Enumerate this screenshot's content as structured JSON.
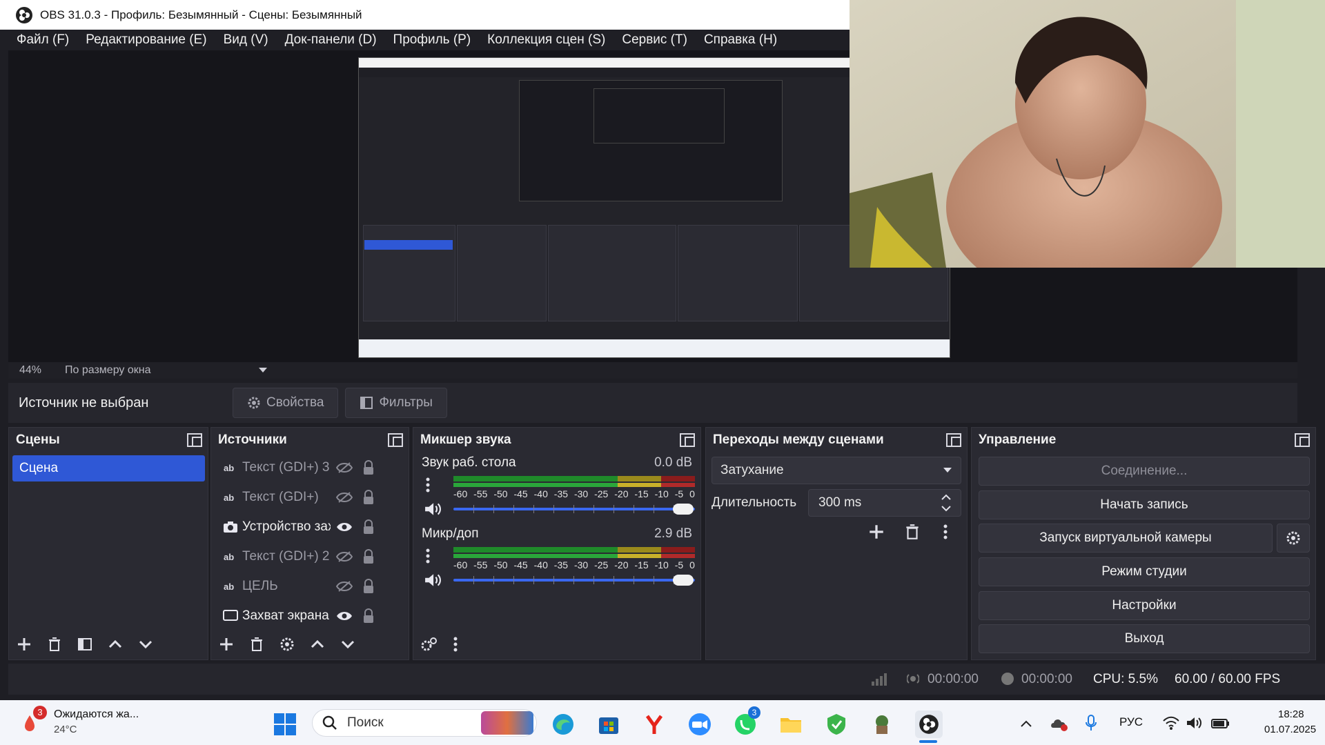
{
  "window": {
    "title": "OBS 31.0.3 - Профиль: Безымянный - Сцены: Безымянный"
  },
  "menu": [
    "Файл (F)",
    "Редактирование (E)",
    "Вид (V)",
    "Док-панели (D)",
    "Профиль (P)",
    "Коллекция сцен (S)",
    "Сервис (T)",
    "Справка (H)"
  ],
  "zoom": {
    "percent": "44%",
    "mode": "По размеру окна"
  },
  "source_toolbar": {
    "no_source": "Источник не выбран",
    "properties": "Свойства",
    "filters": "Фильтры"
  },
  "scenes": {
    "title": "Сцены",
    "items": [
      "Сцена"
    ]
  },
  "sources": {
    "title": "Источники",
    "items": [
      {
        "type": "text",
        "name": "Текст (GDI+) 3",
        "visible": false
      },
      {
        "type": "text",
        "name": "Текст (GDI+)",
        "visible": false
      },
      {
        "type": "camera",
        "name": "Устройство захвата видео",
        "visible": true
      },
      {
        "type": "text",
        "name": "Текст (GDI+) 2",
        "visible": false
      },
      {
        "type": "text",
        "name": "ЦЕЛЬ",
        "visible": false
      },
      {
        "type": "screen",
        "name": "Захват экрана",
        "visible": true
      }
    ]
  },
  "mixer": {
    "title": "Микшер звука",
    "scale": [
      "-60",
      "-55",
      "-50",
      "-45",
      "-40",
      "-35",
      "-30",
      "-25",
      "-20",
      "-15",
      "-10",
      "-5",
      "0"
    ],
    "channels": [
      {
        "name": "Звук раб. стола",
        "db": "0.0 dB",
        "volume": 1.0
      },
      {
        "name": "Микр/доп",
        "db": "2.9 dB",
        "volume": 1.0
      }
    ]
  },
  "transitions": {
    "title": "Переходы между сценами",
    "selected": "Затухание",
    "duration_label": "Длительность",
    "duration_value": "300 ms"
  },
  "controls": {
    "title": "Управление",
    "connect": "Соединение...",
    "record": "Начать запись",
    "virtual_cam": "Запуск виртуальной камеры",
    "studio": "Режим студии",
    "settings": "Настройки",
    "exit": "Выход"
  },
  "status": {
    "stream_time": "00:00:00",
    "rec_time": "00:00:00",
    "cpu": "CPU: 5.5%",
    "fps": "60.00 / 60.00 FPS"
  },
  "taskbar": {
    "weather_badge": "3",
    "weather_text": "Ожидаются жа...",
    "weather_temp": "24°C",
    "search_placeholder": "Поиск",
    "whatsapp_badge": "3",
    "language": "РУС",
    "time": "18:28",
    "date": "01.07.2025"
  },
  "colors": {
    "accent": "#2f58d6",
    "meter_green": "#1f8a2a",
    "meter_yellow": "#9a8a1c",
    "meter_red": "#8a1c1c"
  }
}
